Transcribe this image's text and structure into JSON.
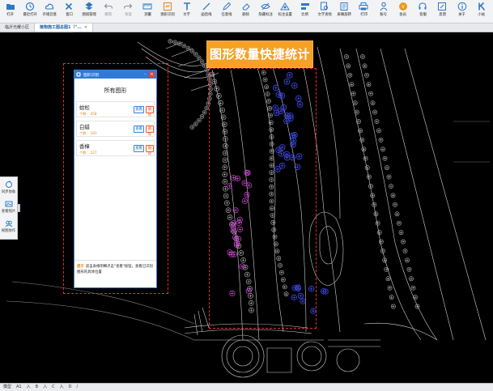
{
  "toolbar": {
    "items": [
      {
        "label": "打开",
        "icon": "folder-open-icon",
        "color": "#2f78c8",
        "disabled": false
      },
      {
        "label": "最近打开",
        "icon": "clock-icon",
        "color": "#2f78c8",
        "disabled": false
      },
      {
        "label": "存储云盘",
        "icon": "cloud-icon",
        "color": "#2f78c8",
        "disabled": false
      },
      {
        "label": "窗口",
        "icon": "close-x-icon",
        "color": "#2f78c8",
        "disabled": false
      },
      {
        "label": "图纸管理",
        "icon": "drawing-manage-icon",
        "color": "#2f78c8",
        "disabled": false
      },
      {
        "label": "撤销",
        "icon": "undo-icon",
        "color": "#8a8f96",
        "disabled": true
      },
      {
        "label": "恢复",
        "icon": "redo-icon",
        "color": "#8a8f96",
        "disabled": true
      },
      {
        "label": "测量",
        "icon": "measure-icon",
        "color": "#2f78c8",
        "disabled": false
      },
      {
        "label": "图形识别",
        "icon": "shape-recognize-icon",
        "color": "#e48a2a",
        "disabled": false
      },
      {
        "label": "文字",
        "icon": "text-icon",
        "color": "#2f78c8",
        "disabled": false
      },
      {
        "label": "画直线",
        "icon": "line-icon",
        "color": "#2f78c8",
        "disabled": false
      },
      {
        "label": "任意线",
        "icon": "pencil-icon",
        "color": "#2f78c8",
        "disabled": false
      },
      {
        "label": "删除",
        "icon": "eraser-icon",
        "color": "#2f78c8",
        "disabled": false
      },
      {
        "label": "隐藏标注",
        "icon": "hide-annotation-icon",
        "color": "#2f78c8",
        "disabled": false
      },
      {
        "label": "标注设置",
        "icon": "annotation-settings-icon",
        "color": "#2f78c8",
        "disabled": false
      },
      {
        "label": "比例",
        "icon": "scale-icon",
        "color": "#2f78c8",
        "disabled": false
      },
      {
        "label": "文字查找",
        "icon": "text-search-icon",
        "color": "#2f78c8",
        "disabled": false
      },
      {
        "label": "屏幕旋转",
        "icon": "rotate-screen-icon",
        "color": "#2f78c8",
        "disabled": false
      },
      {
        "label": "打印",
        "icon": "print-icon",
        "color": "#2f78c8",
        "disabled": false
      },
      {
        "label": "账号",
        "icon": "account-icon",
        "color": "#2f78c8",
        "disabled": false
      },
      {
        "label": "会员",
        "icon": "vip-icon",
        "color": "#e89a1c",
        "disabled": false
      },
      {
        "label": "客服",
        "icon": "headset-icon",
        "color": "#2f78c8",
        "disabled": false
      },
      {
        "label": "反馈",
        "icon": "feedback-icon",
        "color": "#2f78c8",
        "disabled": false
      },
      {
        "label": "关于",
        "icon": "info-icon",
        "color": "#2f78c8",
        "disabled": false
      },
      {
        "label": "小站",
        "icon": "site-k-icon",
        "color": "#2f78c8",
        "disabled": false
      }
    ]
  },
  "tabs": [
    {
      "label": "临沂光耀小区",
      "active": false,
      "close": ""
    },
    {
      "label": "植物施工图总图1（\"...",
      "active": true,
      "close": "×"
    }
  ],
  "sidebar": {
    "items": [
      {
        "label": "同步协助",
        "icon": "sync-icon"
      },
      {
        "label": "查看照片",
        "icon": "photo-icon"
      },
      {
        "label": "视图协作",
        "icon": "collaboration-icon"
      }
    ]
  },
  "dialog": {
    "title": "图形识别",
    "heading": "所有图形",
    "count_label": "个数：",
    "view_label": "查看",
    "delete_label": "删除",
    "rows": [
      {
        "name": "蚊松",
        "count": "458"
      },
      {
        "name": "白蜡",
        "count": "193"
      },
      {
        "name": "香樟",
        "count": "227"
      }
    ],
    "tip_label": "提示",
    "tip_text": "双击表格明细点击\"查看\"按钮，查看已识别图形的具体位置"
  },
  "callout": "图形数量快捷统计",
  "statusbar": {
    "items": [
      "模型",
      "A1",
      "入",
      "B",
      "入",
      "C",
      "入",
      "D",
      "/"
    ]
  },
  "colors": {
    "canvas_bg": "#000000",
    "accent": "#2f79d7",
    "callout": "#f5a127",
    "outline": "#e23030",
    "tree_blue": "#3b45d6",
    "tree_magenta": "#d34ad6"
  }
}
